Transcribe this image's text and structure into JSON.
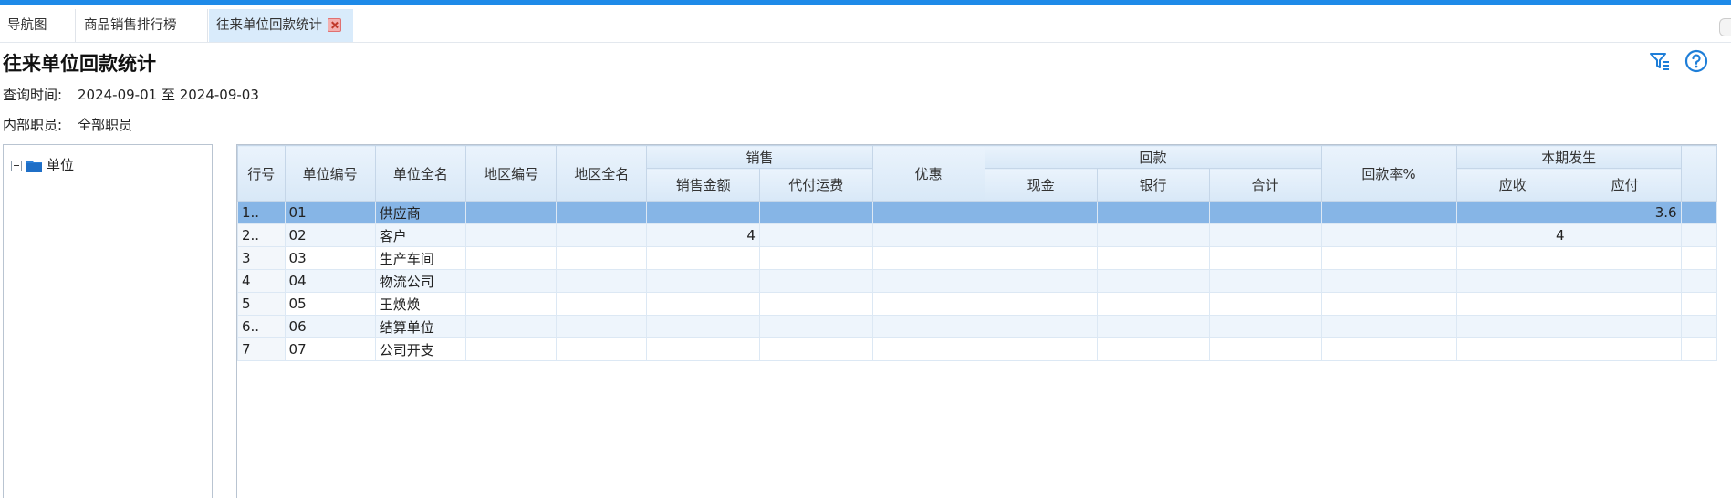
{
  "tabs": [
    {
      "label": "导航图"
    },
    {
      "label": "商品销售排行榜"
    },
    {
      "label": "往来单位回款统计",
      "active": true
    }
  ],
  "page": {
    "title": "往来单位回款统计",
    "query_time_label": "查询时间:",
    "query_time_value": "2024-09-01 至 2024-09-03",
    "staff_label": "内部职员:",
    "staff_value": "全部职员"
  },
  "toolbar": {
    "icons": [
      "filter-icon",
      "help-icon"
    ]
  },
  "tree": {
    "root_label": "单位"
  },
  "grid": {
    "headers": {
      "row_no": "行号",
      "unit_code": "单位编号",
      "unit_name": "单位全名",
      "region_code": "地区编号",
      "region_name": "地区全名",
      "sales_group": "销售",
      "sales_amount": "销售金额",
      "freight": "代付运费",
      "discount": "优惠",
      "payment_group": "回款",
      "cash": "现金",
      "bank": "银行",
      "total": "合计",
      "rate": "回款率%",
      "period_group": "本期发生",
      "receivable": "应收",
      "payable": "应付"
    },
    "rows": [
      {
        "row_no": "1..",
        "unit_code": "01",
        "unit_name": "供应商",
        "sales_amount": "",
        "receivable": "",
        "payable": "3.6"
      },
      {
        "row_no": "2..",
        "unit_code": "02",
        "unit_name": "客户",
        "sales_amount": "4",
        "receivable": "4",
        "payable": ""
      },
      {
        "row_no": "3",
        "unit_code": "03",
        "unit_name": "生产车间",
        "sales_amount": "",
        "receivable": "",
        "payable": ""
      },
      {
        "row_no": "4",
        "unit_code": "04",
        "unit_name": "物流公司",
        "sales_amount": "",
        "receivable": "",
        "payable": ""
      },
      {
        "row_no": "5",
        "unit_code": "05",
        "unit_name": "王焕焕",
        "sales_amount": "",
        "receivable": "",
        "payable": ""
      },
      {
        "row_no": "6..",
        "unit_code": "06",
        "unit_name": "结算单位",
        "sales_amount": "",
        "receivable": "",
        "payable": ""
      },
      {
        "row_no": "7",
        "unit_code": "07",
        "unit_name": "公司开支",
        "sales_amount": "",
        "receivable": "",
        "payable": ""
      }
    ],
    "selected_row": 0
  },
  "colors": {
    "accent": "#1e8ae8",
    "selected_row": "#86b5e6",
    "header_bg": "#d8e8f7"
  }
}
